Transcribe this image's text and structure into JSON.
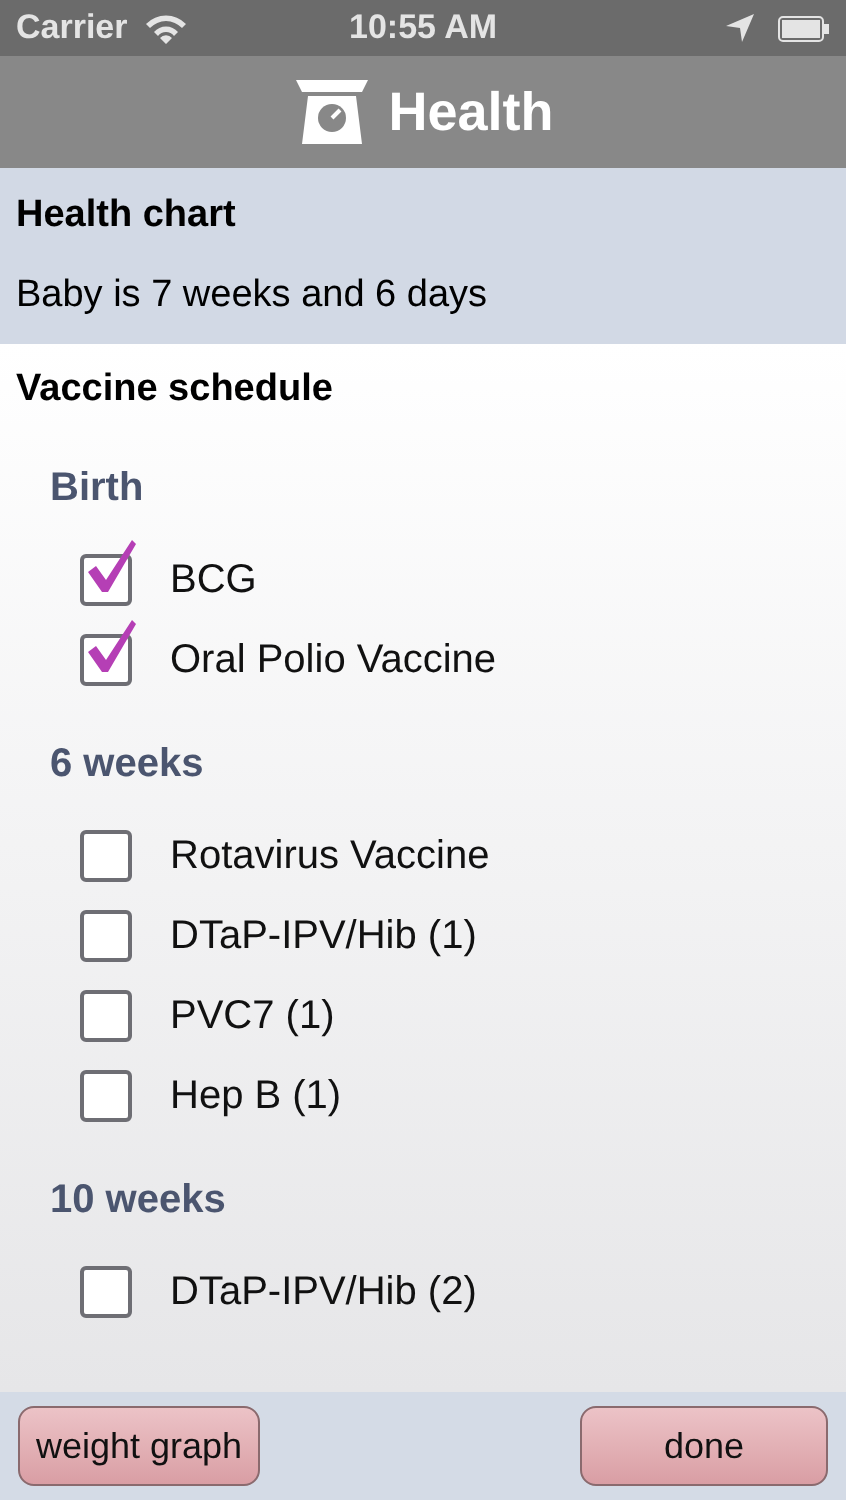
{
  "status_bar": {
    "carrier": "Carrier",
    "time": "10:55 AM"
  },
  "nav": {
    "title": "Health"
  },
  "header": {
    "title": "Health chart",
    "subtitle": "Baby is 7 weeks and 6 days"
  },
  "schedule": {
    "title": "Vaccine schedule",
    "groups": [
      {
        "label": "Birth",
        "items": [
          {
            "label": "BCG",
            "checked": true
          },
          {
            "label": "Oral Polio Vaccine",
            "checked": true
          }
        ]
      },
      {
        "label": "6 weeks",
        "items": [
          {
            "label": "Rotavirus Vaccine",
            "checked": false
          },
          {
            "label": "DTaP-IPV/Hib (1)",
            "checked": false
          },
          {
            "label": "PVC7 (1)",
            "checked": false
          },
          {
            "label": "Hep B (1)",
            "checked": false
          }
        ]
      },
      {
        "label": "10 weeks",
        "items": [
          {
            "label": "DTaP-IPV/Hib (2)",
            "checked": false
          }
        ]
      }
    ]
  },
  "buttons": [
    "weight graph",
    "done"
  ]
}
